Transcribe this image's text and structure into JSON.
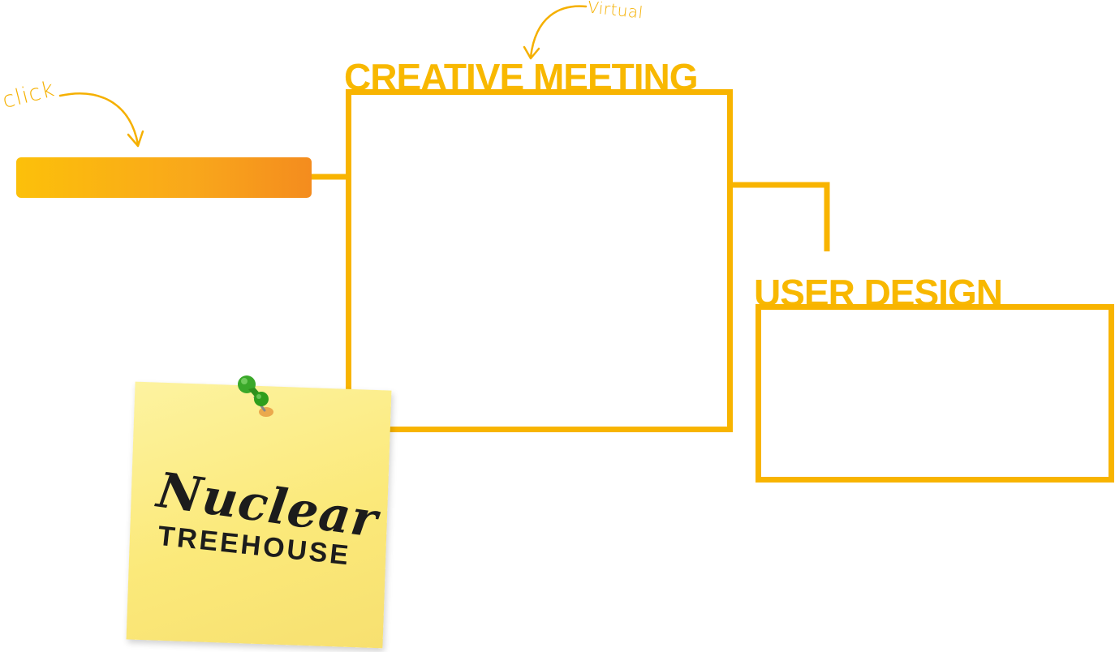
{
  "annotations": {
    "click_note": "click",
    "virtual_note": "Virtual"
  },
  "sections": {
    "creative": {
      "title": "CREATIVE MEETING"
    },
    "user": {
      "title": "USER DESIGN"
    }
  },
  "sticky_note": {
    "logo_script": "Nuclear",
    "logo_block": "TREEHOUSE",
    "pin_icon": "green-pushpin-icon"
  },
  "colors": {
    "accent_yellow": "#f8b400",
    "bar_start": "#fcc00a",
    "bar_end": "#f48c1e",
    "sticky_yellow": "#fbe97a",
    "pin_green": "#2f9e1c"
  }
}
